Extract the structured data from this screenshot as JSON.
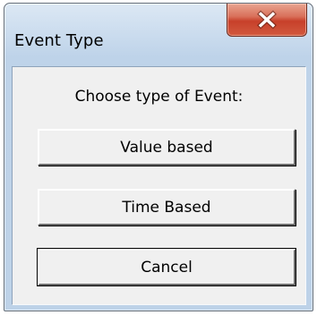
{
  "window": {
    "title": "Event Type"
  },
  "titlebar": {
    "close_icon": "close-icon"
  },
  "dialog": {
    "prompt": "Choose type of Event:",
    "buttons": [
      {
        "label": "Value based"
      },
      {
        "label": "Time Based"
      },
      {
        "label": "Cancel"
      }
    ]
  }
}
